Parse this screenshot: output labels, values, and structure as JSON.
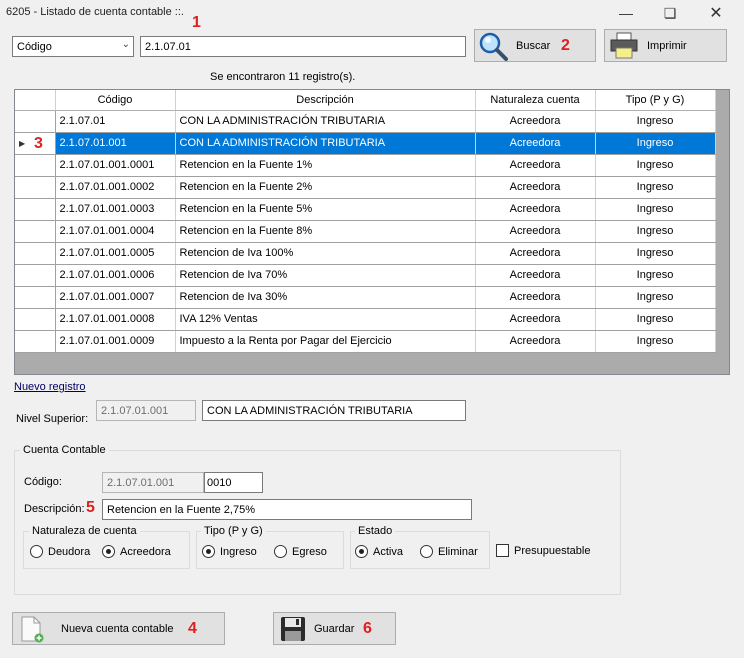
{
  "window": {
    "title": "6205 - Listado de cuenta contable ::."
  },
  "annotations": [
    "1",
    "2",
    "3",
    "4",
    "5",
    "6"
  ],
  "search": {
    "field_selected": "Código",
    "value": "2.1.07.01",
    "buscar_label": "Buscar",
    "imprimir_label": "Imprimir",
    "result_text": "Se encontraron 11 registro(s)."
  },
  "grid": {
    "columns": [
      "Código",
      "Descripción",
      "Naturaleza cuenta",
      "Tipo (P y G)"
    ],
    "rows": [
      [
        "2.1.07.01",
        "CON LA ADMINISTRACIÓN TRIBUTARIA",
        "Acreedora",
        "Ingreso"
      ],
      [
        "2.1.07.01.001",
        "CON LA ADMINISTRACIÓN TRIBUTARIA",
        "Acreedora",
        "Ingreso"
      ],
      [
        "2.1.07.01.001.0001",
        "Retencion en la Fuente 1%",
        "Acreedora",
        "Ingreso"
      ],
      [
        "2.1.07.01.001.0002",
        "Retencion en la Fuente 2%",
        "Acreedora",
        "Ingreso"
      ],
      [
        "2.1.07.01.001.0003",
        "Retencion en la Fuente 5%",
        "Acreedora",
        "Ingreso"
      ],
      [
        "2.1.07.01.001.0004",
        "Retencion en la Fuente 8%",
        "Acreedora",
        "Ingreso"
      ],
      [
        "2.1.07.01.001.0005",
        "Retencion de Iva 100%",
        "Acreedora",
        "Ingreso"
      ],
      [
        "2.1.07.01.001.0006",
        "Retencion de Iva 70%",
        "Acreedora",
        "Ingreso"
      ],
      [
        "2.1.07.01.001.0007",
        "Retencion de Iva 30%",
        "Acreedora",
        "Ingreso"
      ],
      [
        "2.1.07.01.001.0008",
        "IVA 12% Ventas",
        "Acreedora",
        "Ingreso"
      ],
      [
        "2.1.07.01.001.0009",
        "Impuesto a la Renta por Pagar del Ejercicio",
        "Acreedora",
        "Ingreso"
      ]
    ],
    "selected_row": 1
  },
  "form": {
    "nuevo_registro": "Nuevo registro",
    "nivel_label": "Nivel Superior:",
    "nivel_code": "2.1.07.01.001",
    "nivel_desc": "CON LA ADMINISTRACIÓN TRIBUTARIA",
    "cuenta_title": "Cuenta Contable",
    "codigo_label": "Código:",
    "codigo_prefix": "2.1.07.01.001",
    "codigo_value": "0010",
    "descripcion_label": "Descripción:",
    "descripcion_value": "Retencion en la Fuente 2,75%",
    "naturaleza": {
      "title": "Naturaleza de cuenta",
      "options": [
        "Deudora",
        "Acreedora"
      ],
      "selected": "Acreedora"
    },
    "tipo": {
      "title": "Tipo (P y G)",
      "options": [
        "Ingreso",
        "Egreso"
      ],
      "selected": "Ingreso"
    },
    "estado": {
      "title": "Estado",
      "options": [
        "Activa",
        "Eliminar"
      ],
      "selected": "Activa"
    },
    "presupuestable_label": "Presupuestable",
    "presupuestable_checked": false
  },
  "buttons": {
    "nueva_label": "Nueva cuenta contable",
    "guardar_label": "Guardar"
  }
}
